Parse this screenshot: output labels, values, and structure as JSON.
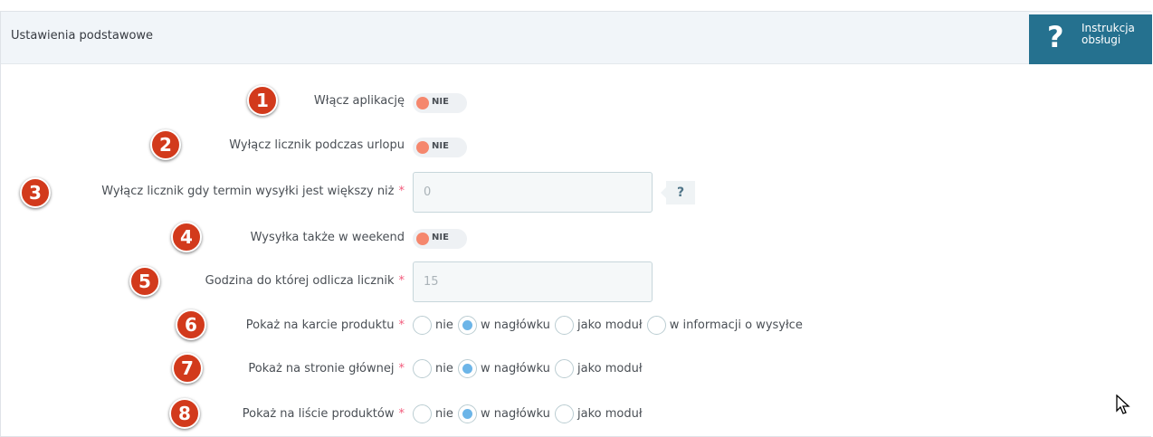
{
  "header": {
    "title": "Ustawienia podstawowe"
  },
  "help": {
    "icon": "?",
    "line1": "Instrukcja",
    "line2": "obsługi"
  },
  "rows": [
    {
      "num": "1",
      "label": "Włącz aplikację",
      "required": "",
      "toggle": "NIE"
    },
    {
      "num": "2",
      "label": "Wyłącz licznik podczas urlopu",
      "required": "",
      "toggle": "NIE"
    },
    {
      "num": "3",
      "label": "Wyłącz licznik gdy termin wysyłki jest większy niż",
      "required": "*",
      "value": "0",
      "help": "?"
    },
    {
      "num": "4",
      "label": "Wysyłka także w weekend",
      "required": "",
      "toggle": "NIE"
    },
    {
      "num": "5",
      "label": "Godzina do której odlicza licznik",
      "required": "*",
      "value": "15"
    },
    {
      "num": "6",
      "label": "Pokaż na karcie produktu",
      "required": "*",
      "options": [
        "nie",
        "w nagłówku",
        "jako moduł",
        "w informacji o wysyłce"
      ],
      "selected": "w nagłówku"
    },
    {
      "num": "7",
      "label": "Pokaż na stronie głównej",
      "required": "*",
      "options": [
        "nie",
        "w nagłówku",
        "jako moduł"
      ],
      "selected": "w nagłówku"
    },
    {
      "num": "8",
      "label": "Pokaż na liście produktów",
      "required": "*",
      "options": [
        "nie",
        "w nagłówku",
        "jako moduł"
      ],
      "selected": "w nagłówku"
    }
  ]
}
